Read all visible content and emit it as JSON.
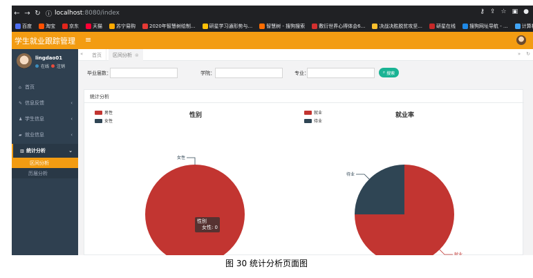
{
  "browser": {
    "address_host": "localhost",
    "address_path": ":8080/index",
    "bookmarks": [
      "百度",
      "淘宝",
      "京东",
      "天猫",
      "苏宁易购",
      "2020年智慧树绘制...",
      "研星学习通形势与...",
      "智慧树 - 搜狗搜索",
      "敷衍世界心得体会6...",
      "决战决胜脱贫攻坚...",
      "研星在线",
      "搜狗网址导航 - ...",
      "计算机操作系统(第..."
    ]
  },
  "app": {
    "title": "学生就业跟踪管理"
  },
  "user": {
    "name": "lingdao01",
    "status": "在线",
    "logout": "注销"
  },
  "sidebar": {
    "items": [
      {
        "label": "首页"
      },
      {
        "label": "信息反馈"
      },
      {
        "label": "学生信息"
      },
      {
        "label": "就业信息"
      },
      {
        "label": "统计分析"
      }
    ],
    "sub_items": [
      {
        "label": "区间分析"
      },
      {
        "label": "历届分析"
      }
    ]
  },
  "tabs": {
    "home": "首页",
    "active": "区间分析"
  },
  "search": {
    "year_label": "毕业届数：",
    "college_label": "学院：",
    "major_label": "专业：",
    "button_label": "搜索"
  },
  "panel": {
    "title": "统计分析"
  },
  "chart_data": [
    {
      "type": "pie",
      "title": "性别",
      "slices": [
        {
          "name": "男性",
          "value": 1
        },
        {
          "name": "女性",
          "value": 0
        }
      ],
      "colors": [
        "#c23531",
        "#2f4554"
      ],
      "legend_position": "top-left",
      "tooltip": {
        "series": "性别",
        "text": "女性: 0"
      }
    },
    {
      "type": "pie",
      "title": "就业率",
      "slices": [
        {
          "name": "就业",
          "value": 3
        },
        {
          "name": "待业",
          "value": 1
        }
      ],
      "colors": [
        "#c23531",
        "#2f4554"
      ],
      "legend_position": "top-left"
    }
  ],
  "caption": "图 30 统计分析页面图"
}
